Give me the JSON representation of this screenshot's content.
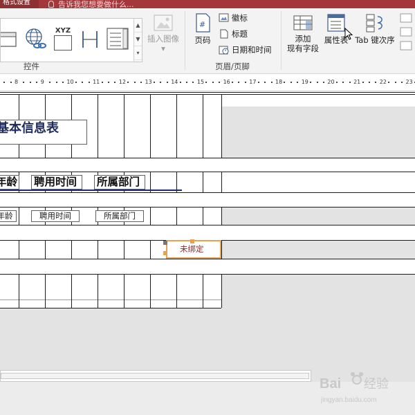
{
  "titlebar": {
    "active_tab": "格式设置",
    "tell_me": "告诉我您想要做什么..."
  },
  "ribbon": {
    "controls_group_label": "控件",
    "insert_image_label": "插入图像",
    "insert_image_dropdown": "▾",
    "page_number_label": "页码",
    "logo_label": "徽标",
    "title_label": "标题",
    "date_time_label": "日期和时间",
    "header_footer_group_label": "页眉/页脚",
    "add_existing_fields_line1": "添加",
    "add_existing_fields_line2": "现有字段",
    "property_sheet_label": "属性表",
    "tab_order_label": "Tab 键次序",
    "xyz_icon_text": "XYZ",
    "gallery_scroll": [
      "▲",
      "▼",
      "▾"
    ]
  },
  "ruler": {
    "numbers": [
      "8",
      "9",
      "10",
      "11",
      "12",
      "13",
      "14",
      "15",
      "16",
      "17",
      "18",
      "19",
      "20",
      "21",
      "22",
      "23"
    ]
  },
  "report": {
    "title": "基本信息表",
    "header_labels": [
      "年龄",
      "聘用时间",
      "所属部门"
    ],
    "detail_fields": [
      "年龄",
      "聘用时间",
      "所属部门"
    ],
    "unbound_text": "未绑定"
  },
  "colors": {
    "titlebar": "#a4373a",
    "selection": "#e8a24f",
    "title_text": "#1d2a5a",
    "gray_area": "#e3e3e3"
  }
}
